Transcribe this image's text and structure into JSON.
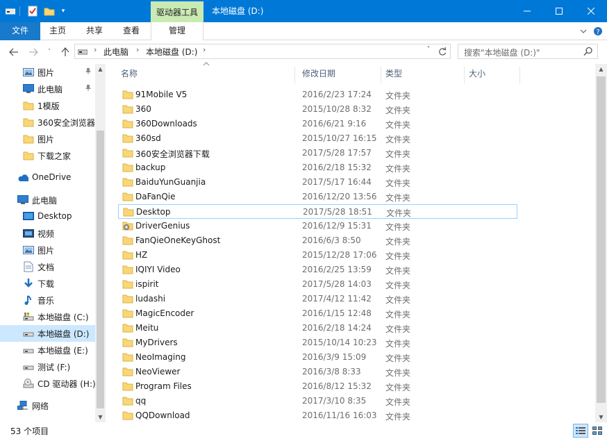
{
  "window": {
    "title": "本地磁盘 (D:)",
    "context_tab": "驱动器工具"
  },
  "ribbon": {
    "tabs": [
      "文件",
      "主页",
      "共享",
      "查看",
      "管理"
    ]
  },
  "address": {
    "segments": [
      "此电脑",
      "本地磁盘 (D:)"
    ]
  },
  "search": {
    "placeholder": "搜索\"本地磁盘 (D:)\""
  },
  "nav": {
    "items": [
      {
        "label": "图片",
        "icon": "pictures-icon",
        "pinned": true
      },
      {
        "label": "此电脑",
        "icon": "computer-icon",
        "pinned": true
      },
      {
        "label": "1模版",
        "icon": "folder-icon",
        "pinned": false
      },
      {
        "label": "360安全浏览器",
        "icon": "folder-icon",
        "pinned": false
      },
      {
        "label": "图片",
        "icon": "folder-icon",
        "pinned": false
      },
      {
        "label": "下载之家",
        "icon": "folder-icon",
        "pinned": false
      },
      {
        "label": "OneDrive",
        "icon": "onedrive-icon",
        "pinned": false
      },
      {
        "label": "此电脑",
        "icon": "computer-icon",
        "pinned": false
      },
      {
        "label": "Desktop",
        "icon": "desktop-icon",
        "pinned": false
      },
      {
        "label": "视频",
        "icon": "videos-icon",
        "pinned": false
      },
      {
        "label": "图片",
        "icon": "pictures-icon",
        "pinned": false
      },
      {
        "label": "文档",
        "icon": "documents-icon",
        "pinned": false
      },
      {
        "label": "下载",
        "icon": "download-icon",
        "pinned": false
      },
      {
        "label": "音乐",
        "icon": "music-icon",
        "pinned": false
      },
      {
        "label": "本地磁盘 (C:)",
        "icon": "drive-c-icon",
        "pinned": false
      },
      {
        "label": "本地磁盘 (D:)",
        "icon": "drive-icon",
        "pinned": false,
        "selected": true
      },
      {
        "label": "本地磁盘 (E:)",
        "icon": "drive-icon",
        "pinned": false
      },
      {
        "label": "测试 (F:)",
        "icon": "drive-icon",
        "pinned": false
      },
      {
        "label": "CD 驱动器 (H:)",
        "icon": "cd-drive-icon",
        "pinned": false
      },
      {
        "label": "网络",
        "icon": "network-icon",
        "pinned": false
      }
    ]
  },
  "list": {
    "columns": [
      "名称",
      "修改日期",
      "类型",
      "大小"
    ],
    "rows": [
      {
        "name": "91Mobile V5",
        "date": "2016/2/23 17:24",
        "type": "文件夹"
      },
      {
        "name": "360",
        "date": "2015/10/28 8:32",
        "type": "文件夹"
      },
      {
        "name": "360Downloads",
        "date": "2016/6/21 9:16",
        "type": "文件夹"
      },
      {
        "name": "360sd",
        "date": "2015/10/27 16:15",
        "type": "文件夹"
      },
      {
        "name": "360安全浏览器下载",
        "date": "2017/5/28 17:57",
        "type": "文件夹"
      },
      {
        "name": "backup",
        "date": "2016/2/18 15:32",
        "type": "文件夹"
      },
      {
        "name": "BaiduYunGuanjia",
        "date": "2017/5/17 16:44",
        "type": "文件夹"
      },
      {
        "name": "DaFanQie",
        "date": "2016/12/20 13:56",
        "type": "文件夹"
      },
      {
        "name": "Desktop",
        "date": "2017/5/28 18:51",
        "type": "文件夹",
        "focused": true
      },
      {
        "name": "DriverGenius",
        "date": "2016/12/9 15:31",
        "type": "文件夹",
        "special": true
      },
      {
        "name": "FanQieOneKeyGhost",
        "date": "2016/6/3 8:50",
        "type": "文件夹"
      },
      {
        "name": "HZ",
        "date": "2015/12/28 17:06",
        "type": "文件夹"
      },
      {
        "name": "IQIYI Video",
        "date": "2016/2/25 13:59",
        "type": "文件夹"
      },
      {
        "name": "ispirit",
        "date": "2017/5/28 14:03",
        "type": "文件夹"
      },
      {
        "name": "ludashi",
        "date": "2017/4/12 11:42",
        "type": "文件夹"
      },
      {
        "name": "MagicEncoder",
        "date": "2016/1/15 12:48",
        "type": "文件夹"
      },
      {
        "name": "Meitu",
        "date": "2016/2/18 14:24",
        "type": "文件夹"
      },
      {
        "name": "MyDrivers",
        "date": "2015/10/14 10:23",
        "type": "文件夹"
      },
      {
        "name": "NeoImaging",
        "date": "2016/3/9 15:09",
        "type": "文件夹"
      },
      {
        "name": "NeoViewer",
        "date": "2016/3/8 8:33",
        "type": "文件夹"
      },
      {
        "name": "Program Files",
        "date": "2016/8/12 15:32",
        "type": "文件夹"
      },
      {
        "name": "qq",
        "date": "2017/3/10 8:35",
        "type": "文件夹"
      },
      {
        "name": "QQDownload",
        "date": "2016/11/16 16:03",
        "type": "文件夹"
      }
    ]
  },
  "status": {
    "item_count": "53 个项目"
  },
  "colors": {
    "titlebar": "#0078d7",
    "context_tab": "#c9ebb3",
    "selection": "#cce8ff",
    "folder": "#f8d775"
  }
}
